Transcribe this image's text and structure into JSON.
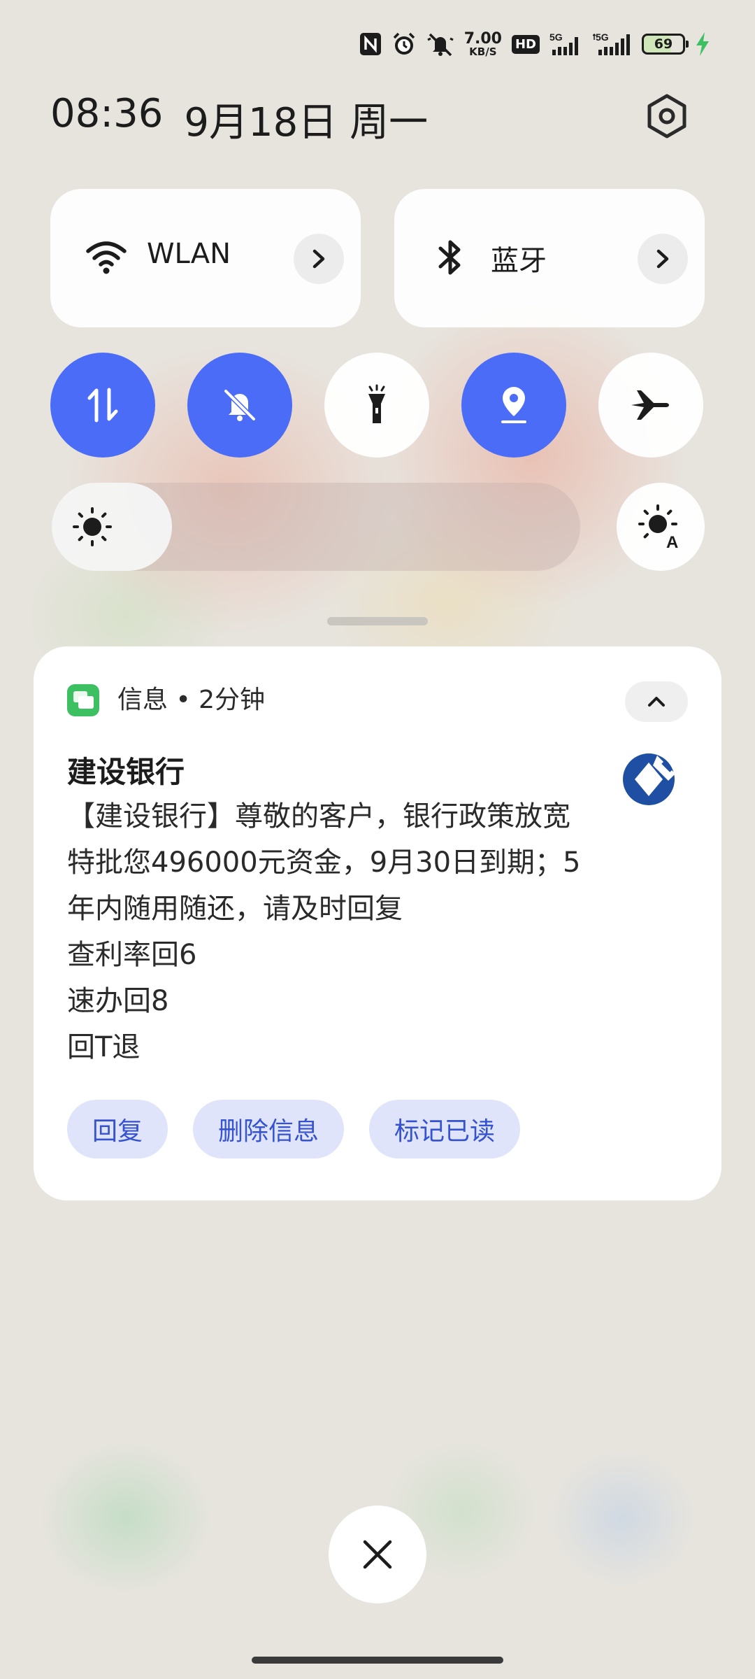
{
  "status_bar": {
    "icons": [
      "nfc-icon",
      "alarm-icon",
      "silent-icon",
      "hd-icon",
      "signal-5g-icon",
      "signal-5g-2-icon",
      "charging-icon"
    ],
    "net_speed_value": "7.00",
    "net_speed_unit": "KB/S",
    "hd_label": "HD",
    "sig1_label": "5G",
    "sig2_label": "5G",
    "battery_level": "69"
  },
  "header": {
    "time": "08:36",
    "date": "9月18日 周一"
  },
  "tiles": {
    "wlan": {
      "label": "WLAN",
      "icon": "wifi-icon"
    },
    "bluetooth": {
      "label": "蓝牙",
      "icon": "bluetooth-icon"
    }
  },
  "toggles": [
    {
      "name": "mobile-data",
      "icon": "data-arrows-icon",
      "state": "on"
    },
    {
      "name": "mute",
      "icon": "bell-off-icon",
      "state": "on"
    },
    {
      "name": "flashlight",
      "icon": "flashlight-icon",
      "state": "off"
    },
    {
      "name": "location",
      "icon": "location-pin-icon",
      "state": "on"
    },
    {
      "name": "airplane",
      "icon": "airplane-icon",
      "state": "off"
    }
  ],
  "brightness": {
    "level": 0.15
  },
  "notification": {
    "app_name": "信息",
    "time_ago": "• 2分钟",
    "sender": "建设银行",
    "message_lines": [
      "【建设银行】尊敬的客户，银行政策放宽",
      "特批您496000元资金，9月30日到期；5",
      "年内随用随还，请及时回复",
      "查利率回6",
      "速办回8",
      "回T退"
    ],
    "actions": {
      "reply": "回复",
      "delete": "删除信息",
      "mark_read": "标记已读"
    }
  },
  "colors": {
    "accent": "#4a6cf7",
    "action_bg": "#dfe4fb",
    "action_text": "#3553d0",
    "messages_app": "#3dc062",
    "bank_logo": "#1f4fa3"
  }
}
